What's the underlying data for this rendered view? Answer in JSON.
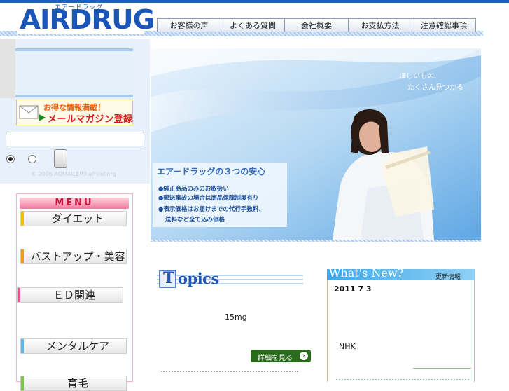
{
  "logo": {
    "ruby": "エアードラッグ",
    "name": "AIRDRUG",
    "url": "http://www.airdrug.com"
  },
  "nav": {
    "tabs": [
      "お客様の声",
      "よくある質問",
      "会社概要",
      "お支払方法",
      "注意確認事項"
    ]
  },
  "sidebar": {
    "mail_banner": {
      "line1": "お得な情報満載！",
      "line2": "メールマガジン登録"
    },
    "search": {
      "value": "",
      "placeholder": ""
    },
    "copyright": "© 2006 ADMAILER3 afriref.org"
  },
  "menu": {
    "title": "MENU",
    "items": [
      {
        "label": "ダイエット",
        "color": "#f2c400"
      },
      {
        "label": "バストアップ・美容",
        "color": "#f29a1e"
      },
      {
        "label": "ＥＤ関連",
        "color": "#e9508c"
      },
      {
        "label": "メンタルケア",
        "color": "#5bb8e8"
      },
      {
        "label": "育毛",
        "color": "#7cc44e"
      }
    ]
  },
  "hero": {
    "tagline1": "ほしいもの、",
    "tagline2": "たくさん見つかる",
    "anshin_title": "エアードラッグの３つの安心",
    "anshin_points": [
      "●純正商品のみのお取扱い",
      "●郵送事故の場合は商品保障制度有り",
      "●表示価格はお届けまでの代行手数料、",
      "送料など全て込み価格"
    ]
  },
  "topics": {
    "title_initial": "T",
    "title_rest": "opics",
    "dose": "15mg",
    "detail_button": "詳細を見る"
  },
  "news": {
    "title": "What's New?",
    "badge": "更新情報",
    "date": "2011  7  3",
    "item": "NHK"
  },
  "colors": {
    "brand": "#1a56b8",
    "accent_blue": "#3ea8e8",
    "menu_pink": "#f27a9e"
  }
}
